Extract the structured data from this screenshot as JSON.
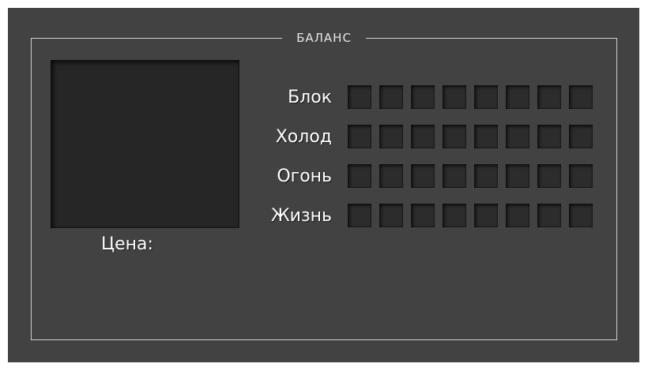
{
  "panel": {
    "title": "БАЛАНС",
    "price_label": "Цена:"
  },
  "stats": [
    {
      "name": "block",
      "label": "Блок",
      "level": 0,
      "max": 8
    },
    {
      "name": "cold",
      "label": "Холод",
      "level": 0,
      "max": 8
    },
    {
      "name": "fire",
      "label": "Огонь",
      "level": 0,
      "max": 8
    },
    {
      "name": "life",
      "label": "Жизнь",
      "level": 0,
      "max": 8
    }
  ],
  "colors": {
    "panel_bg": "#424242",
    "frame_border": "#cfcfcf",
    "cell_empty": "#2c2c2c",
    "preview_bg": "#262626",
    "text": "#ffffff"
  }
}
